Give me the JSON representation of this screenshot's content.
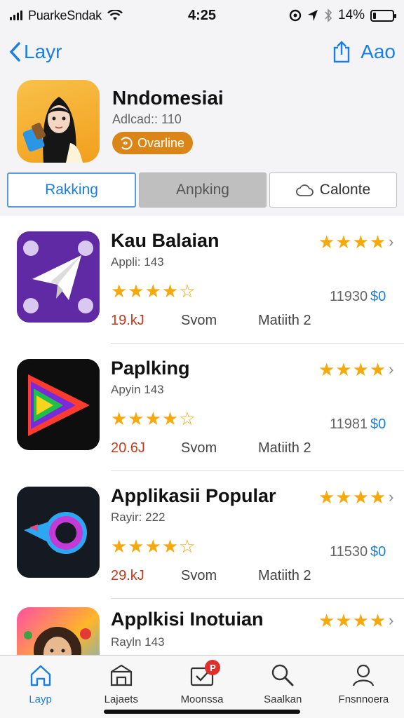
{
  "status": {
    "carrier": "PuarkeSndak",
    "time": "4:25",
    "battery": "14%",
    "battery_level": 0.14
  },
  "nav": {
    "back_label": "Layr",
    "action_label": "Aao"
  },
  "header": {
    "title": "Nndomesiai",
    "subtitle": "Adlcad:: 110",
    "badge": "Ovarline"
  },
  "segments": [
    {
      "label": "Rakking",
      "state": "active"
    },
    {
      "label": "Anpking",
      "state": "mid"
    },
    {
      "label": "Calonte",
      "state": "normal",
      "icon": "cloud-icon"
    }
  ],
  "apps": [
    {
      "name": "Kau Balaian",
      "sub": "Appli: 143",
      "price": "19.kJ",
      "size": "Svom",
      "tag": "Matiith 2",
      "count": "11930",
      "cost": "$0",
      "rating": 4,
      "icon": "paper-plane-icon"
    },
    {
      "name": "Paplking",
      "sub": "Apyin 143",
      "price": "20.6J",
      "size": "Svom",
      "tag": "Matiith 2",
      "count": "11981",
      "cost": "$0",
      "rating": 4,
      "icon": "play-arrow-icon"
    },
    {
      "name": "Applikasii Popular",
      "sub": "Rayir: 222",
      "price": "29.kJ",
      "size": "Svom",
      "tag": "Matiith 2",
      "count": "11530",
      "cost": "$0",
      "rating": 4,
      "icon": "ring-icon"
    },
    {
      "name": "Applkisi Inotuian",
      "sub": "Rayln 143",
      "price": "",
      "size": "",
      "tag": "",
      "count": "",
      "cost": "",
      "rating": 4,
      "icon": "portrait-icon"
    }
  ],
  "stars_text": "★★★★☆",
  "right_stars_text": "★★★★",
  "tabs": [
    {
      "label": "Layp",
      "icon": "house-icon",
      "active": true
    },
    {
      "label": "Lajaets",
      "icon": "box-icon",
      "active": false
    },
    {
      "label": "Moonssa",
      "icon": "check-mail-icon",
      "active": false,
      "badge": "P"
    },
    {
      "label": "Saalkan",
      "icon": "search-icon",
      "active": false
    },
    {
      "label": "Fnsnnoera",
      "icon": "person-icon",
      "active": false
    }
  ]
}
